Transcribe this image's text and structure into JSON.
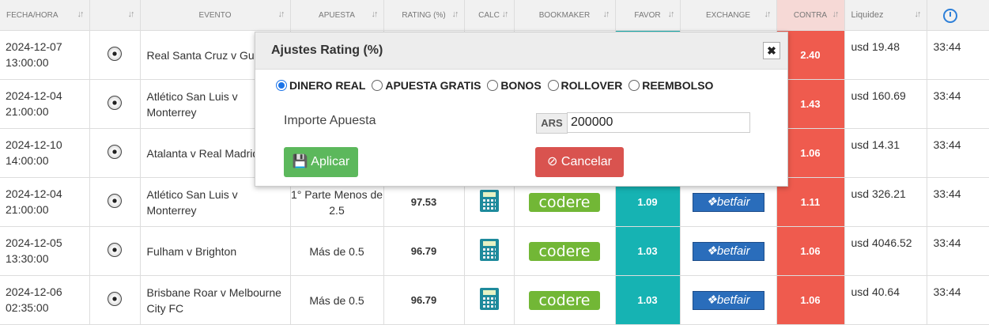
{
  "headers": [
    "FECHA/HORA",
    "",
    "EVENTO",
    "APUESTA",
    "RATING (%)",
    "CALC",
    "BOOKMAKER",
    "FAVOR",
    "EXCHANGE",
    "CONTRA",
    "Liquidez",
    ""
  ],
  "rows": [
    {
      "date": "2024-12-07",
      "time": "13:00:00",
      "event": "Real Santa Cruz v Gua",
      "bet": "",
      "rating": "",
      "bookmaker": "",
      "favor": "",
      "exchange": "",
      "contra": "2.40",
      "liquidity": "usd 19.48",
      "remaining": "33:44"
    },
    {
      "date": "2024-12-04",
      "time": "21:00:00",
      "event": "Atlético San Luis v Monterrey",
      "bet": "",
      "rating": "",
      "bookmaker": "",
      "favor": "",
      "exchange": "",
      "contra": "1.43",
      "liquidity": "usd 160.69",
      "remaining": "33:44"
    },
    {
      "date": "2024-12-10",
      "time": "14:00:00",
      "event": "Atalanta v Real Madrid",
      "bet": "",
      "rating": "",
      "bookmaker": "",
      "favor": "",
      "exchange": "",
      "contra": "1.06",
      "liquidity": "usd 14.31",
      "remaining": "33:44"
    },
    {
      "date": "2024-12-04",
      "time": "21:00:00",
      "event": "Atlético San Luis v Monterrey",
      "bet": "1° Parte Menos de 2.5",
      "rating": "97.53",
      "bookmaker": "codere",
      "favor": "1.09",
      "exchange": "betfair",
      "contra": "1.11",
      "liquidity": "usd 326.21",
      "remaining": "33:44"
    },
    {
      "date": "2024-12-05",
      "time": "13:30:00",
      "event": "Fulham v Brighton",
      "bet": "Más de 0.5",
      "rating": "96.79",
      "bookmaker": "codere",
      "favor": "1.03",
      "exchange": "betfair",
      "contra": "1.06",
      "liquidity": "usd 4046.52",
      "remaining": "33:44"
    },
    {
      "date": "2024-12-06",
      "time": "02:35:00",
      "event": "Brisbane Roar v Melbourne City FC",
      "bet": "Más de 0.5",
      "rating": "96.79",
      "bookmaker": "codere",
      "favor": "1.03",
      "exchange": "betfair",
      "contra": "1.06",
      "liquidity": "usd 40.64",
      "remaining": "33:44"
    }
  ],
  "sort_icon": "↓↑",
  "modal": {
    "title": "Ajustes Rating (%)",
    "close": "✖",
    "options": [
      "DINERO REAL",
      "APUESTA GRATIS",
      "BONOS",
      "ROLLOVER",
      "REEMBOLSO"
    ],
    "selected_option": "DINERO REAL",
    "amount_label": "Importe Apuesta",
    "currency": "ARS",
    "amount_value": "200000",
    "apply_label": "Aplicar",
    "cancel_label": "Cancelar"
  },
  "colors": {
    "favor": "#16b3b3",
    "contra": "#ef5b4e",
    "apply": "#5cb85c",
    "cancel": "#d9534f"
  }
}
